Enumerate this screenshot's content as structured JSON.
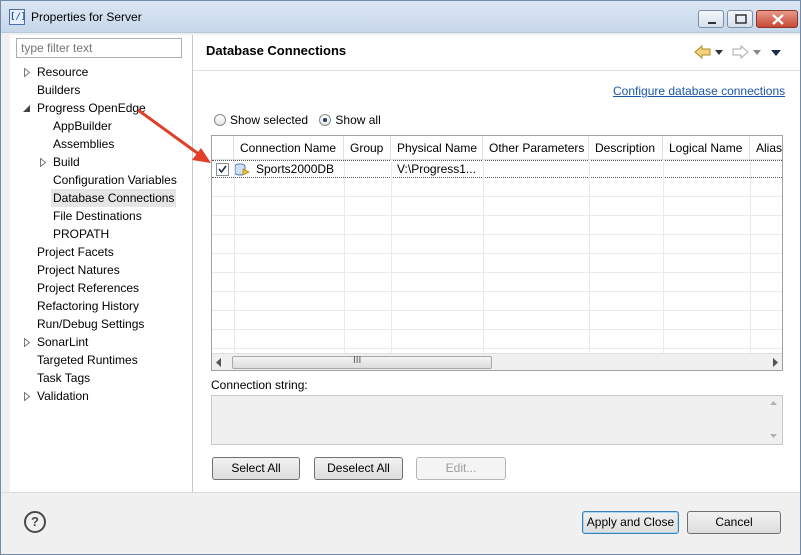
{
  "window": {
    "title": "Properties for Server",
    "icon": "eclipse-properties-icon"
  },
  "filter": {
    "placeholder": "type filter text"
  },
  "tree": [
    {
      "label": "Resource",
      "expand": "collapsed",
      "level": 1
    },
    {
      "label": "Builders",
      "expand": "none",
      "level": 1
    },
    {
      "label": "Progress OpenEdge",
      "expand": "expanded",
      "level": 1
    },
    {
      "label": "AppBuilder",
      "expand": "none",
      "level": 2
    },
    {
      "label": "Assemblies",
      "expand": "none",
      "level": 2
    },
    {
      "label": "Build",
      "expand": "collapsed",
      "level": 2
    },
    {
      "label": "Configuration Variables",
      "expand": "none",
      "level": 2
    },
    {
      "label": "Database Connections",
      "expand": "none",
      "level": 2,
      "selected": true
    },
    {
      "label": "File Destinations",
      "expand": "none",
      "level": 2
    },
    {
      "label": "PROPATH",
      "expand": "none",
      "level": 2
    },
    {
      "label": "Project Facets",
      "expand": "none",
      "level": 1
    },
    {
      "label": "Project Natures",
      "expand": "none",
      "level": 1
    },
    {
      "label": "Project References",
      "expand": "none",
      "level": 1
    },
    {
      "label": "Refactoring History",
      "expand": "none",
      "level": 1
    },
    {
      "label": "Run/Debug Settings",
      "expand": "none",
      "level": 1
    },
    {
      "label": "SonarLint",
      "expand": "collapsed",
      "level": 1
    },
    {
      "label": "Targeted Runtimes",
      "expand": "none",
      "level": 1
    },
    {
      "label": "Task Tags",
      "expand": "none",
      "level": 1
    },
    {
      "label": "Validation",
      "expand": "collapsed",
      "level": 1
    }
  ],
  "page": {
    "title": "Database Connections",
    "configure_link": "Configure database connections",
    "show_selected": "Show selected",
    "show_all": "Show all",
    "radio_selected": "show_all"
  },
  "table": {
    "columns": [
      "Connection Name",
      "Group",
      "Physical Name",
      "Other Parameters",
      "Description",
      "Logical Name",
      "Alias"
    ],
    "rows": [
      {
        "checked": true,
        "connection_name": "Sports2000DB",
        "group": "",
        "physical_name": "V:\\Progress1...",
        "other_parameters": "",
        "description": "",
        "logical_name": "",
        "alias": ""
      }
    ],
    "scrollbar_grip": "III"
  },
  "connection_string": {
    "label": "Connection string:",
    "value": ""
  },
  "buttons": {
    "select_all": "Select All",
    "deselect_all": "Deselect All",
    "edit": "Edit...",
    "apply_close": "Apply and Close",
    "cancel": "Cancel",
    "help": "?"
  },
  "colors": {
    "link": "#1a56a6",
    "annotation_arrow": "#e0402a",
    "title_bar": "#c7d7ea"
  }
}
